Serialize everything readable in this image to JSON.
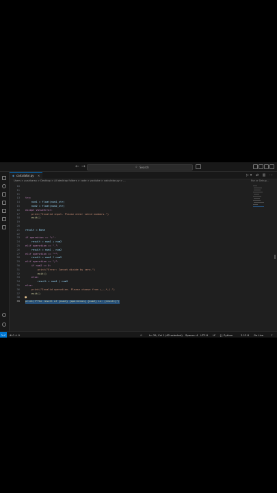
{
  "titlebar": {
    "back": "←",
    "forward": "→",
    "search_placeholder": "Search"
  },
  "tab": {
    "file_name": "calculator.py",
    "close": "×"
  },
  "breadcrumb": "Users > pushkarsa > Desktop > All desktop folders > code > youtube > calculator.py > ...",
  "minimap_hint": "Run or Debug...",
  "editor": {
    "lines": [
      {
        "n": "10",
        "code": ""
      },
      {
        "n": "11",
        "code": ""
      },
      {
        "n": "12",
        "code": ""
      },
      {
        "n": "13",
        "code": "try:"
      },
      {
        "n": "14",
        "code": "    num1 = float(num1_str)"
      },
      {
        "n": "15",
        "code": "    num2 = float(num2_str)"
      },
      {
        "n": "16",
        "code": "except ValueError:"
      },
      {
        "n": "17",
        "code": "    print(\"Invalid input. Please enter valid numbers.\")"
      },
      {
        "n": "18",
        "code": "    exit()"
      },
      {
        "n": "19",
        "code": ""
      },
      {
        "n": "20",
        "code": ""
      },
      {
        "n": "21",
        "code": "result = None"
      },
      {
        "n": "22",
        "code": ""
      },
      {
        "n": "23",
        "code": "if operation == \"+\":"
      },
      {
        "n": "24",
        "code": "    result = num1 + num2"
      },
      {
        "n": "25",
        "code": "elif operation == \"-\":"
      },
      {
        "n": "26",
        "code": "    result = num1 - num2"
      },
      {
        "n": "27",
        "code": "elif operation == \"*\":"
      },
      {
        "n": "28",
        "code": "    result = num1 * num2"
      },
      {
        "n": "29",
        "code": "elif operation == \"/\":"
      },
      {
        "n": "30",
        "code": "    if num2 == 0:"
      },
      {
        "n": "31",
        "code": "        print(\"Error: Cannot divide by zero.\")"
      },
      {
        "n": "32",
        "code": "        exit()"
      },
      {
        "n": "33",
        "code": "    else:"
      },
      {
        "n": "34",
        "code": "        result = num1 / num2"
      },
      {
        "n": "35",
        "code": "else:"
      },
      {
        "n": "36",
        "code": "    print(\"Invalid operation. Please choose from +,-,*,/.\")"
      },
      {
        "n": "37",
        "code": "    exit()"
      },
      {
        "n": "38",
        "code": ""
      },
      {
        "n": "39",
        "code": "print(f\"The result of {num1} {operation} {num2} is: {result}\")"
      }
    ]
  },
  "status": {
    "remote": "><",
    "problems": "⊗ 0 ⚠ 0",
    "position": "Ln 39, Col 1 (62 selected)",
    "spaces": "Spaces: 4",
    "encoding": "UTF-8",
    "eol": "LF",
    "language": "{} Python",
    "interpreter": "3.12.8",
    "golive": "Go Live"
  }
}
